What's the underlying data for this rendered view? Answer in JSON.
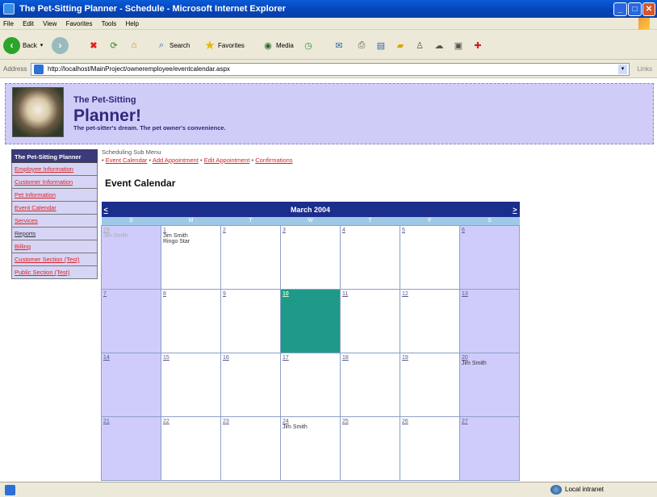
{
  "window": {
    "title": "The Pet-Sitting Planner - Schedule - Microsoft Internet Explorer"
  },
  "menu": [
    "File",
    "Edit",
    "View",
    "Favorites",
    "Tools",
    "Help"
  ],
  "toolbar": {
    "back": "Back",
    "search": "Search",
    "favorites": "Favorites",
    "media": "Media"
  },
  "address": {
    "label": "Address",
    "url": "http://localhost/MainProject/owneremployee/eventcalendar.aspx",
    "links": "Links"
  },
  "brand": {
    "line1": "The Pet-Sitting",
    "line2": "Planner!",
    "tagline": "The pet-sitter's dream. The pet owner's convenience."
  },
  "nav": {
    "heading": "The Pet-Sitting Planner",
    "items": [
      "Employee Information",
      "Customer Information",
      "Pet Information",
      "Event Calendar",
      "Services",
      "Reports",
      "Billing",
      "Customer Section (Test)",
      "Public Section (Test)"
    ]
  },
  "submenu": {
    "title": "Scheduling Sub Menu",
    "links": [
      "Event Calendar",
      "Add Appointment",
      "Edit Appointment",
      "Confirmations"
    ]
  },
  "page_title": "Event Calendar",
  "calendar": {
    "month": "March 2004",
    "prev": "<",
    "next": ">",
    "weekdays": [
      "S",
      "M",
      "T",
      "W",
      "T",
      "F",
      "S"
    ],
    "weeks": [
      [
        {
          "d": "29",
          "events": [
            "Jim Smith"
          ],
          "other": true
        },
        {
          "d": "1",
          "events": [
            "Jim Smith",
            "Ringo Star"
          ]
        },
        {
          "d": "2",
          "events": []
        },
        {
          "d": "3",
          "events": []
        },
        {
          "d": "4",
          "events": []
        },
        {
          "d": "5",
          "events": []
        },
        {
          "d": "6",
          "events": []
        }
      ],
      [
        {
          "d": "7",
          "events": []
        },
        {
          "d": "8",
          "events": []
        },
        {
          "d": "9",
          "events": []
        },
        {
          "d": "10",
          "events": [],
          "today": true
        },
        {
          "d": "11",
          "events": []
        },
        {
          "d": "12",
          "events": []
        },
        {
          "d": "13",
          "events": []
        }
      ],
      [
        {
          "d": "14",
          "events": []
        },
        {
          "d": "15",
          "events": []
        },
        {
          "d": "16",
          "events": []
        },
        {
          "d": "17",
          "events": []
        },
        {
          "d": "18",
          "events": []
        },
        {
          "d": "19",
          "events": []
        },
        {
          "d": "20",
          "events": [
            "Jim Smith"
          ]
        }
      ],
      [
        {
          "d": "21",
          "events": []
        },
        {
          "d": "22",
          "events": []
        },
        {
          "d": "23",
          "events": []
        },
        {
          "d": "24",
          "events": [
            "Jim Smith"
          ]
        },
        {
          "d": "25",
          "events": []
        },
        {
          "d": "26",
          "events": []
        },
        {
          "d": "27",
          "events": []
        }
      ]
    ]
  },
  "status": {
    "zone": "Local intranet"
  }
}
